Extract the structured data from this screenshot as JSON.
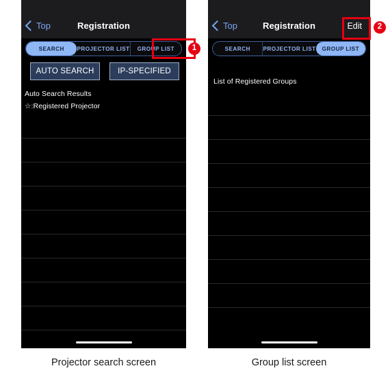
{
  "left_panel": {
    "nav": {
      "back_label": "Top",
      "back_icon": "chevron-left-icon",
      "title": "Registration"
    },
    "segmented": {
      "items": [
        {
          "label": "SEARCH",
          "selected": true
        },
        {
          "label": "PROJECTOR LIST",
          "selected": false
        },
        {
          "label": "GROUP LIST",
          "selected": false
        }
      ]
    },
    "buttons": {
      "auto_search": "AUTO SEARCH",
      "ip_specified": "IP-SPECIFIED"
    },
    "content": {
      "results_label": "Auto Search Results",
      "legend_label": "☆:Registered Projector"
    },
    "caption": "Projector search screen"
  },
  "right_panel": {
    "nav": {
      "back_label": "Top",
      "back_icon": "chevron-left-icon",
      "title": "Registration",
      "action_label": "Edit"
    },
    "segmented": {
      "items": [
        {
          "label": "SEARCH",
          "selected": false
        },
        {
          "label": "PROJECTOR LIST",
          "selected": false
        },
        {
          "label": "GROUP LIST",
          "selected": true
        }
      ]
    },
    "content": {
      "list_label": "List of Registered Groups"
    },
    "caption": "Group list screen"
  },
  "callouts": [
    {
      "number": "1",
      "target": "group-list-segment-left"
    },
    {
      "number": "2",
      "target": "edit-button-right"
    }
  ],
  "colors": {
    "callout_red": "#e60012",
    "accent_blue": "#7aa7f5",
    "segment_selected_bg": "#8fb6f5",
    "button_bg": "#2c3d5c",
    "panel_bg": "#000000",
    "navbar_bg": "#1c1c1e"
  }
}
